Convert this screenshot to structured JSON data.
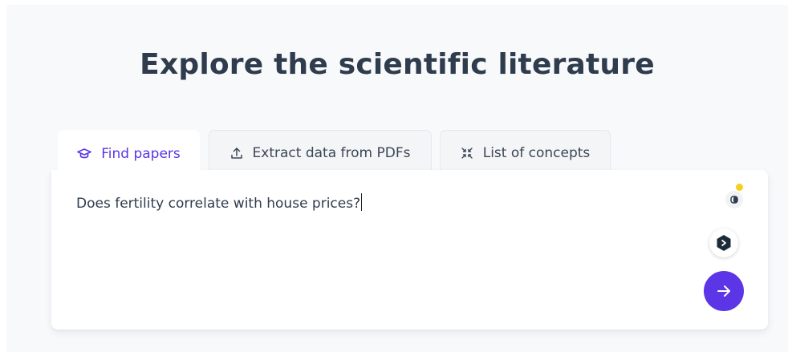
{
  "page": {
    "title": "Explore the scientific literature"
  },
  "tabs": [
    {
      "label": "Find papers",
      "icon": "graduation-cap-icon",
      "active": true
    },
    {
      "label": "Extract data from PDFs",
      "icon": "upload-icon",
      "active": false
    },
    {
      "label": "List of concepts",
      "icon": "collapse-arrows-icon",
      "active": false
    }
  ],
  "search": {
    "value": "Does fertility correlate with house prices?"
  },
  "colors": {
    "accent": "#5b35e6",
    "title": "#2f3c4d",
    "notification_dot": "#f5cf1e"
  }
}
